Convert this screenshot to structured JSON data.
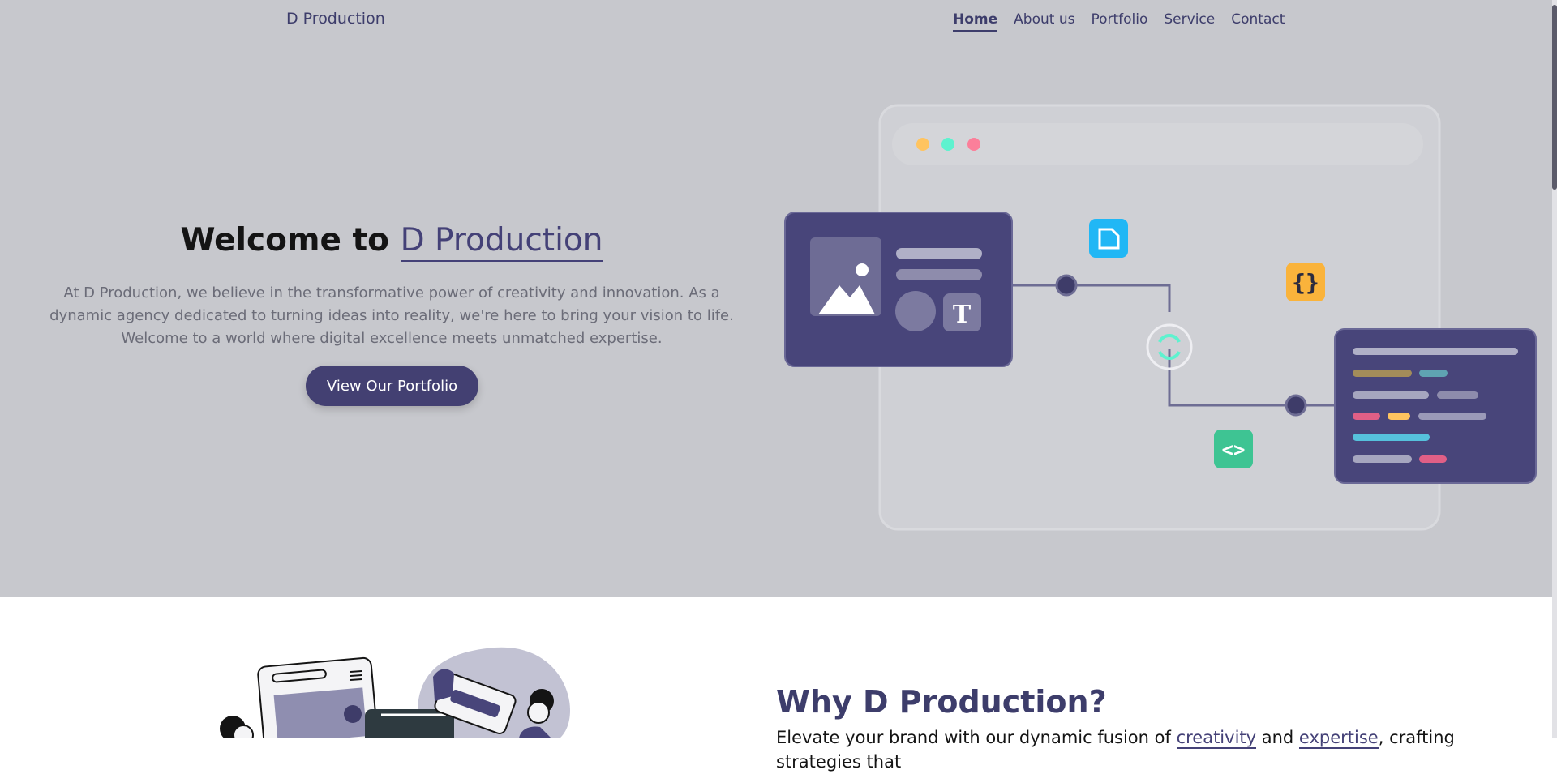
{
  "nav": {
    "brand": "D Production",
    "links": [
      "Home",
      "About us",
      "Portfolio",
      "Service",
      "Contact"
    ]
  },
  "hero": {
    "title_prefix": "Welcome to",
    "title_brand": "D Production",
    "description": "At D Production, we believe in the transformative power of creativity and innovation. As a dynamic agency dedicated to turning ideas into reality, we're here to bring your vision to life. Welcome to a world where digital excellence meets unmatched expertise.",
    "cta": "View Our Portfolio"
  },
  "illustration": {
    "window_dots": [
      "#ffc45f",
      "#5ef2cf",
      "#fb7f9a"
    ],
    "code_badge": "{}",
    "code_tag_badge": "<>",
    "text_tile": "T"
  },
  "why": {
    "title": "Why D Production?",
    "text_a": "Elevate your brand with our dynamic fusion of ",
    "word_1": "creativity",
    "text_b": " and ",
    "word_2": "expertise",
    "text_c": ", crafting strategies that"
  },
  "colors": {
    "primary": "#434072",
    "hero_bg": "#c7c8cd"
  }
}
